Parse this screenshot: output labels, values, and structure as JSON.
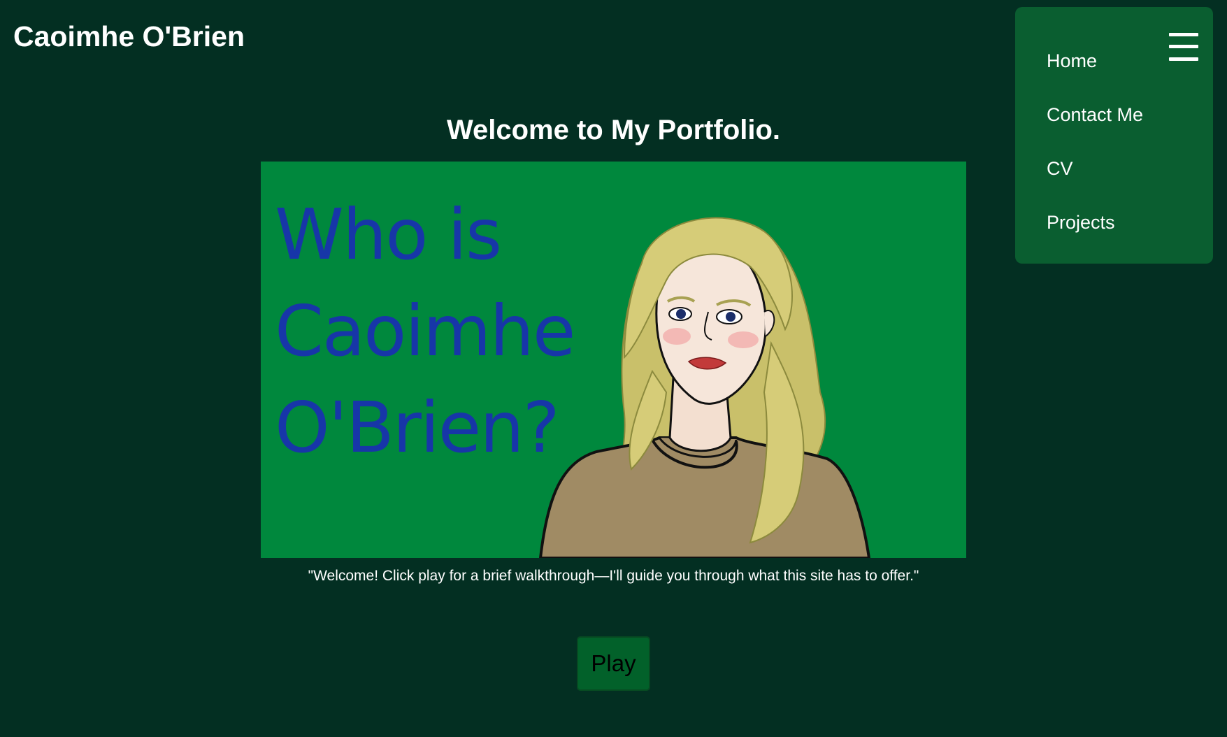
{
  "header": {
    "site_title": "Caoimhe O'Brien"
  },
  "nav": {
    "items": [
      {
        "label": "Home"
      },
      {
        "label": "Contact Me"
      },
      {
        "label": "CV"
      },
      {
        "label": "Projects"
      }
    ],
    "menu_icon": "hamburger-menu-icon"
  },
  "main": {
    "heading": "Welcome to My Portfolio.",
    "hero": {
      "title": "Who is Caoimhe O'Brien?",
      "image_subject": "illustrated portrait of a woman with long blonde hair in a brown sweater"
    },
    "quote": "\"Welcome! Click play for a brief walkthrough—I'll guide you through what this site has to offer.\"",
    "play_label": "Play"
  },
  "colors": {
    "page_background": "#032f22",
    "nav_background": "#0a5e30",
    "hero_background": "#00883d",
    "hero_text": "#1736a8",
    "play_button": "#02612a"
  }
}
